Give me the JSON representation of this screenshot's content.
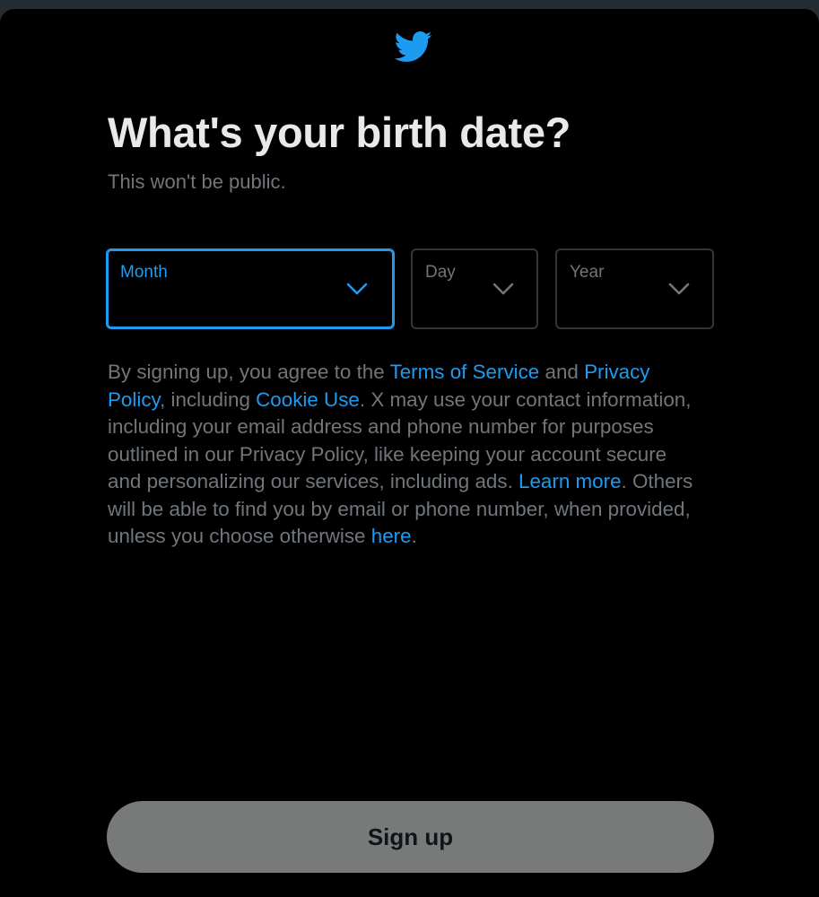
{
  "colors": {
    "background": "#000000",
    "accent": "#1d9bf0",
    "text_primary": "#e7e9ea",
    "text_secondary": "#71767b",
    "border": "#333639",
    "button_disabled": "#787a7a"
  },
  "header": {
    "logo_icon": "twitter-bird-icon"
  },
  "main": {
    "title": "What's your birth date?",
    "subtitle": "This won't be public."
  },
  "birthdate": {
    "month": {
      "label": "Month",
      "value": ""
    },
    "day": {
      "label": "Day",
      "value": ""
    },
    "year": {
      "label": "Year",
      "value": ""
    }
  },
  "legal": {
    "t1": "By signing up, you agree to the ",
    "terms_link": "Terms of Service",
    "t2": " and ",
    "privacy_link": "Privacy Policy",
    "t3": ", including ",
    "cookie_link": "Cookie Use",
    "t4": ". X may use your contact information, including your email address and phone number for purposes outlined in our Privacy Policy, like keeping your account secure and personalizing our services, including ads. ",
    "learn_more_link": "Learn more",
    "t5": ". Others will be able to find you by email or phone number, when provided, unless you choose otherwise ",
    "here_link": "here",
    "t6": "."
  },
  "footer": {
    "signup_label": "Sign up"
  }
}
